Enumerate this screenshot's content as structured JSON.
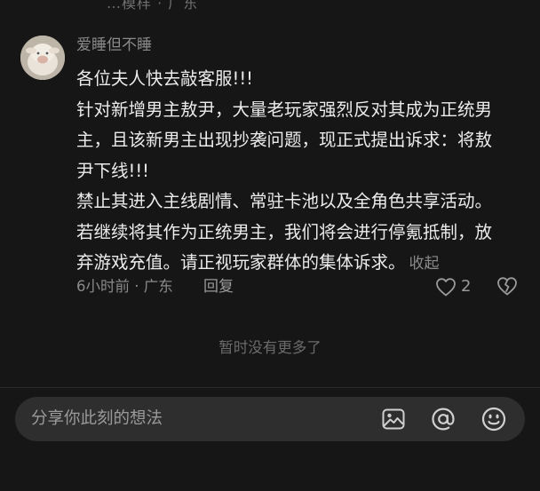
{
  "top_remnant": "…模样 · 广东",
  "comment": {
    "username": "爱睡但不睡",
    "lines": [
      "各位夫人快去敲客服!!!",
      "针对新增男主敖尹，大量老玩家强烈反对其成为正统男",
      "主，且该新男主出现抄袭问题，现正式提出诉求：将敖",
      "尹下线!!!",
      "禁止其进入主线剧情、常驻卡池以及全角色共享活动。",
      "若继续将其作为正统男主，我们将会进行停氪抵制，放",
      "弃游戏充值。请正视玩家群体的集体诉求。"
    ],
    "collapse_label": "收起",
    "meta": "6小时前 · 广东",
    "reply_label": "回复",
    "like_count": "2"
  },
  "no_more_label": "暂时没有更多了",
  "input": {
    "placeholder": "分享你此刻的想法"
  },
  "icons": {
    "image": "image-icon",
    "mention": "at-icon",
    "emoji": "emoji-icon",
    "like": "heart-icon",
    "dislike": "broken-heart-icon"
  }
}
